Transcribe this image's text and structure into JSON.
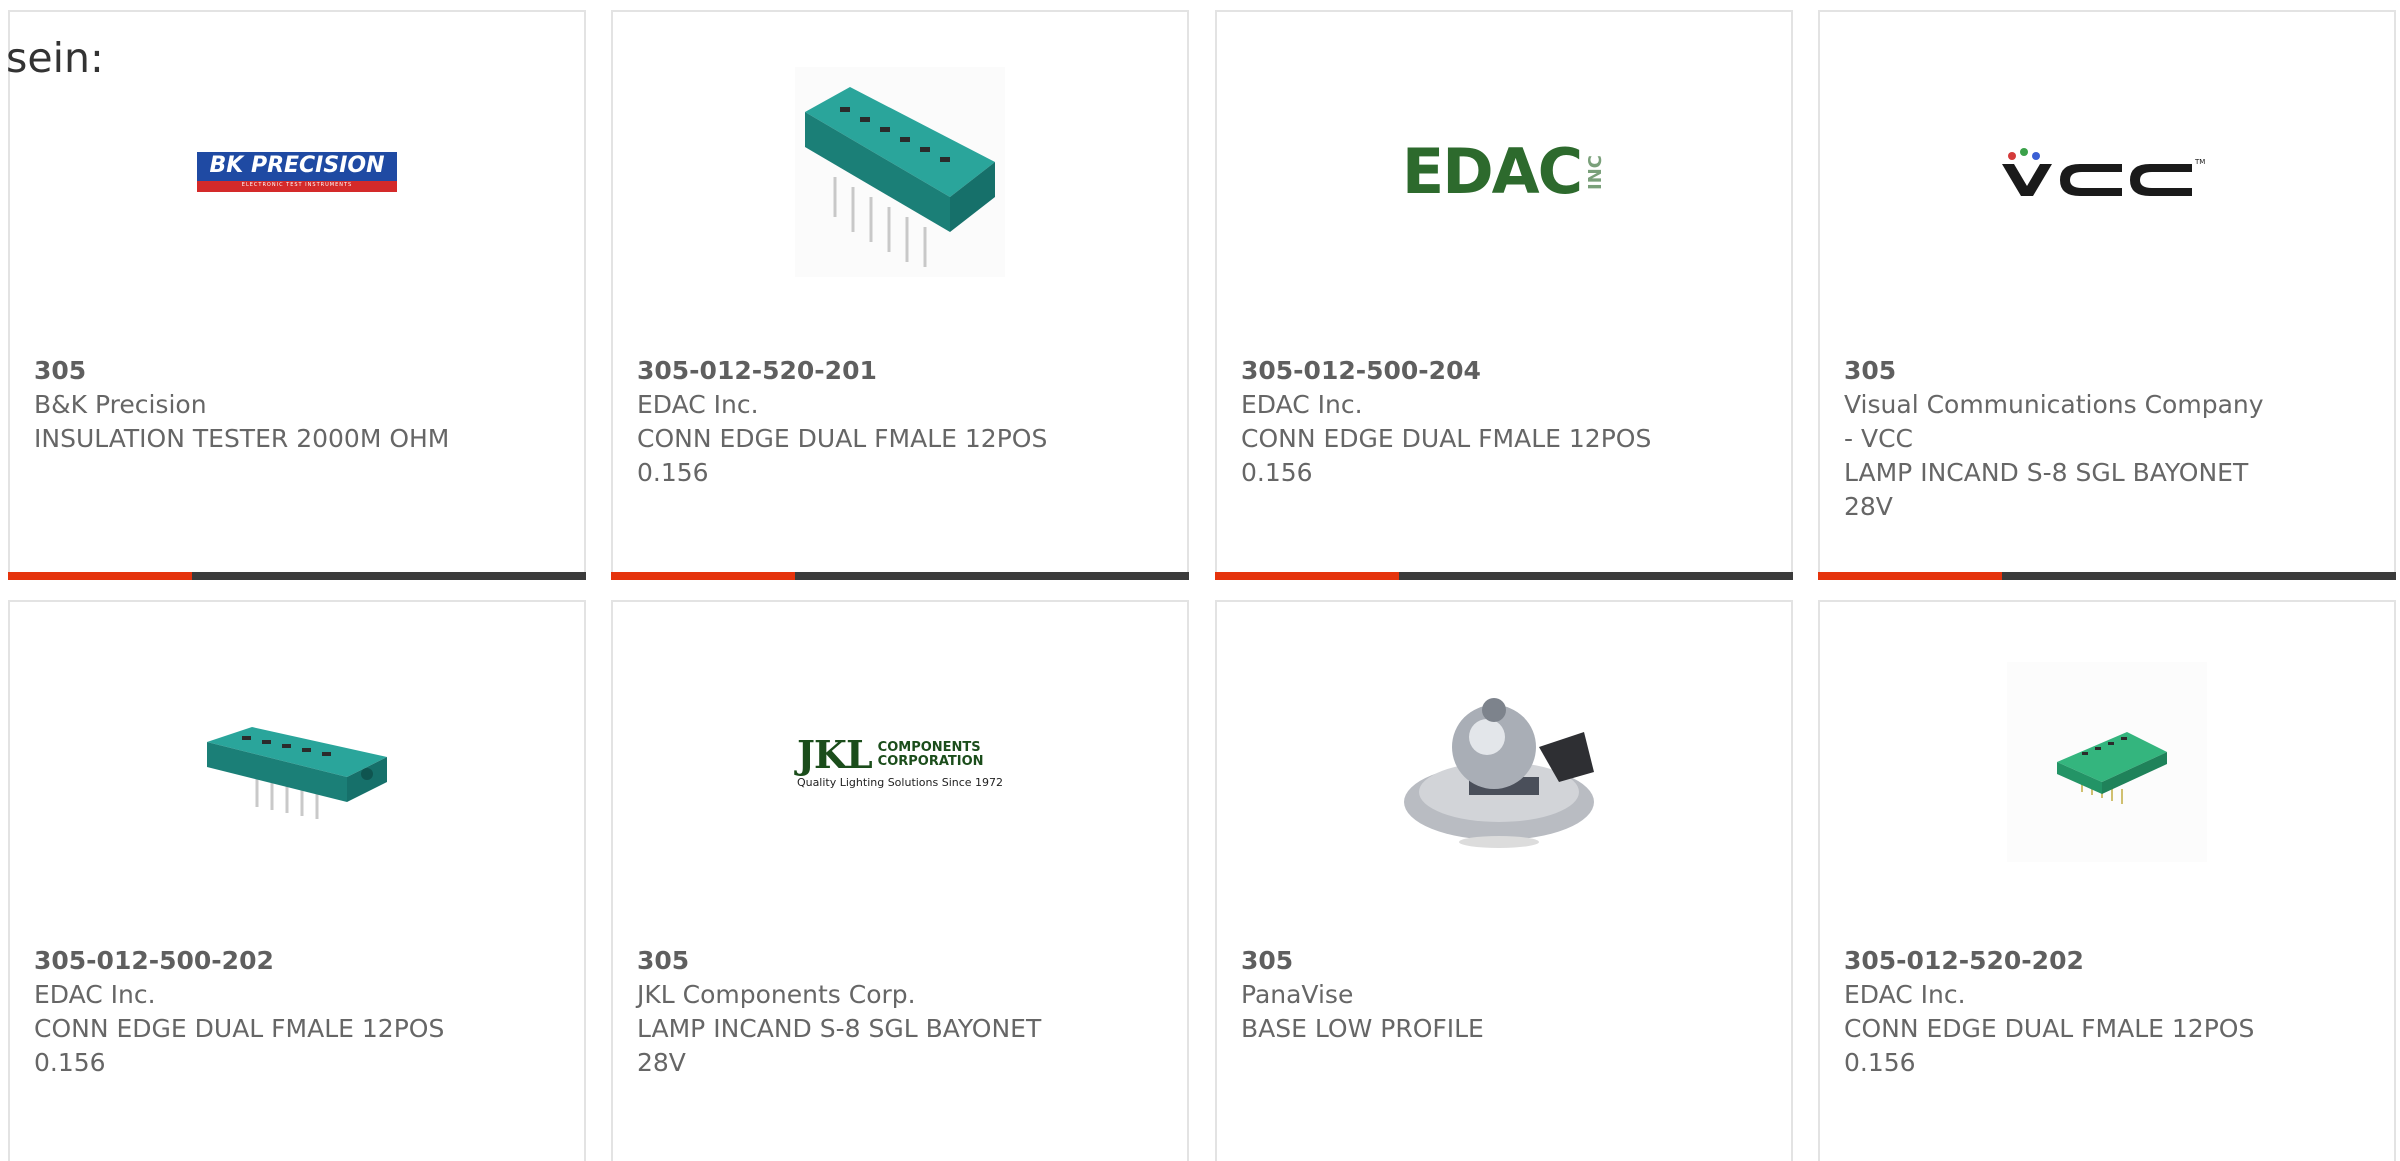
{
  "heading": "sein:",
  "colors": {
    "accent": "#e5330c",
    "bar": "#3b3b3b",
    "card_border": "#e3e3e3",
    "text": "#666666"
  },
  "products": [
    {
      "part_number": "305",
      "manufacturer": "B&K Precision",
      "description": "INSULATION TESTER 2000M OHM",
      "image": "bk-precision-logo",
      "logo_text": "BK PRECISION",
      "logo_subtext": "ELECTRONIC TEST INSTRUMENTS"
    },
    {
      "part_number": "305-012-520-201",
      "manufacturer": "EDAC Inc.",
      "description": "CONN EDGE DUAL FMALE 12POS 0.156",
      "image": "edge-connector-photo"
    },
    {
      "part_number": "305-012-500-204",
      "manufacturer": "EDAC Inc.",
      "description": "CONN EDGE DUAL FMALE 12POS 0.156",
      "image": "edac-logo",
      "logo_text": "EDAC",
      "logo_subtext": "INC"
    },
    {
      "part_number": "305",
      "manufacturer": "Visual Communications Company - VCC",
      "description": "LAMP INCAND S-8 SGL BAYONET 28V",
      "image": "vcc-logo",
      "logo_text": "VCC"
    },
    {
      "part_number": "305-012-500-202",
      "manufacturer": "EDAC Inc.",
      "description": "CONN EDGE DUAL FMALE 12POS 0.156",
      "image": "edge-connector-photo"
    },
    {
      "part_number": "305",
      "manufacturer": "JKL Components Corp.",
      "description": "LAMP INCAND S-8 SGL BAYONET 28V",
      "image": "jkl-logo",
      "logo_text": "JKL",
      "logo_subtext": "COMPONENTS CORPORATION",
      "logo_tagline": "Quality Lighting Solutions Since 1972"
    },
    {
      "part_number": "305",
      "manufacturer": "PanaVise",
      "description": "BASE LOW PROFILE",
      "image": "vise-base-photo"
    },
    {
      "part_number": "305-012-520-202",
      "manufacturer": "EDAC Inc.",
      "description": "CONN EDGE DUAL FMALE 12POS 0.156",
      "image": "edge-connector-small-photo"
    }
  ]
}
